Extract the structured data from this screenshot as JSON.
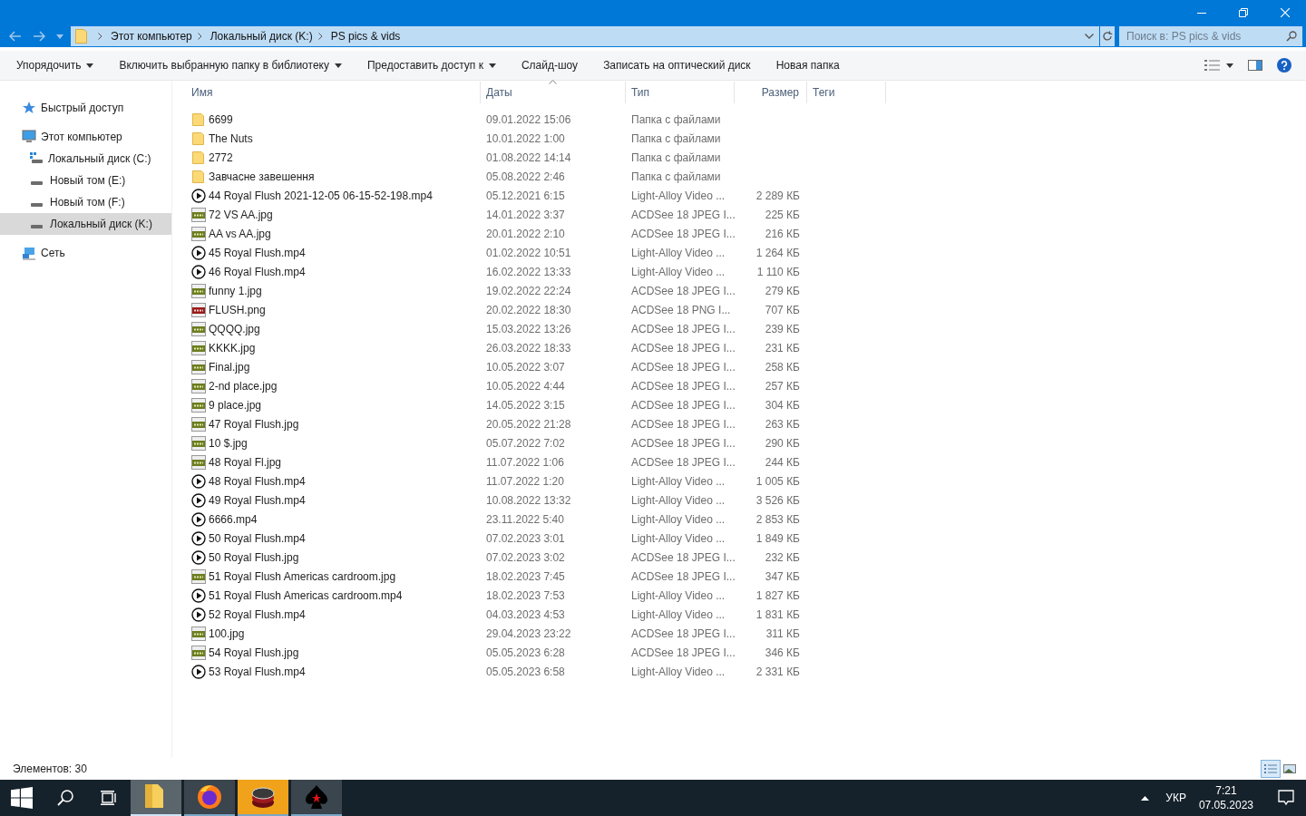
{
  "address_bar": {
    "crumbs": [
      "Этот компьютер",
      "Локальный диск (K:)",
      "PS pics & vids"
    ]
  },
  "search": {
    "placeholder": "Поиск в: PS pics & vids"
  },
  "toolbar": [
    {
      "label": "Упорядочить",
      "dropdown": true
    },
    {
      "label": "Включить выбранную папку в библиотеку",
      "dropdown": true
    },
    {
      "label": "Предоставить доступ к",
      "dropdown": true
    },
    {
      "label": "Слайд-шоу",
      "dropdown": false
    },
    {
      "label": "Записать на оптический диск",
      "dropdown": false
    },
    {
      "label": "Новая папка",
      "dropdown": false
    }
  ],
  "sidebar": {
    "items": [
      {
        "label": "Быстрый доступ",
        "kind": "star",
        "selected": false
      },
      {
        "label": "Этот компьютер",
        "kind": "computer",
        "selected": false,
        "children": [
          {
            "label": "Локальный диск (C:)",
            "kind": "system-drive",
            "selected": false
          },
          {
            "label": "Новый том (E:)",
            "kind": "drive",
            "selected": false
          },
          {
            "label": "Новый том (F:)",
            "kind": "drive",
            "selected": false
          },
          {
            "label": "Локальный диск (K:)",
            "kind": "drive",
            "selected": true
          }
        ]
      },
      {
        "label": "Сеть",
        "kind": "network",
        "selected": false
      }
    ]
  },
  "table": {
    "columns": [
      {
        "label": "Имя",
        "sorted": false
      },
      {
        "label": "Даты",
        "sorted": true
      },
      {
        "label": "Тип",
        "sorted": false
      },
      {
        "label": "Размер",
        "sorted": false
      },
      {
        "label": "Теги",
        "sorted": false
      }
    ],
    "rows": [
      {
        "kind": "folder",
        "name": "6699",
        "date": "09.01.2022 15:06",
        "type": "Папка с файлами"
      },
      {
        "kind": "folder",
        "name": "The Nuts",
        "date": "10.01.2022 1:00",
        "type": "Папка с файлами"
      },
      {
        "kind": "folder",
        "name": "2772",
        "date": "01.08.2022 14:14",
        "type": "Папка с файлами"
      },
      {
        "kind": "folder",
        "name": "Завчасне завешення",
        "date": "05.08.2022 2:46",
        "type": "Папка с файлами"
      },
      {
        "kind": "video",
        "name": "44 Royal Flush 2021-12-05 06-15-52-198.mp4",
        "date": "05.12.2021 6:15",
        "type": "Light-Alloy Video ...",
        "size": "2 289 КБ"
      },
      {
        "kind": "jpg",
        "name": "72 VS AA.jpg",
        "date": "14.01.2022 3:37",
        "type": "ACDSee 18 JPEG I...",
        "size": "225 КБ"
      },
      {
        "kind": "jpg",
        "name": "AA vs AA.jpg",
        "date": "20.01.2022 2:10",
        "type": "ACDSee 18 JPEG I...",
        "size": "216 КБ"
      },
      {
        "kind": "video",
        "name": "45 Royal Flush.mp4",
        "date": "01.02.2022 10:51",
        "type": "Light-Alloy Video ...",
        "size": "1 264 КБ"
      },
      {
        "kind": "video",
        "name": "46 Royal Flush.mp4",
        "date": "16.02.2022 13:33",
        "type": "Light-Alloy Video ...",
        "size": "1 110 КБ"
      },
      {
        "kind": "jpg",
        "name": "funny 1.jpg",
        "date": "19.02.2022 22:24",
        "type": "ACDSee 18 JPEG I...",
        "size": "279 КБ"
      },
      {
        "kind": "png",
        "name": "FLUSH.png",
        "date": "20.02.2022 18:30",
        "type": "ACDSee 18 PNG I...",
        "size": "707 КБ"
      },
      {
        "kind": "jpg",
        "name": "QQQQ.jpg",
        "date": "15.03.2022 13:26",
        "type": "ACDSee 18 JPEG I...",
        "size": "239 КБ"
      },
      {
        "kind": "jpg",
        "name": "KKKK.jpg",
        "date": "26.03.2022 18:33",
        "type": "ACDSee 18 JPEG I...",
        "size": "231 КБ"
      },
      {
        "kind": "jpg",
        "name": "Final.jpg",
        "date": "10.05.2022 3:07",
        "type": "ACDSee 18 JPEG I...",
        "size": "258 КБ"
      },
      {
        "kind": "jpg",
        "name": "2-nd place.jpg",
        "date": "10.05.2022 4:44",
        "type": "ACDSee 18 JPEG I...",
        "size": "257 КБ"
      },
      {
        "kind": "jpg",
        "name": "9 place.jpg",
        "date": "14.05.2022 3:15",
        "type": "ACDSee 18 JPEG I...",
        "size": "304 КБ"
      },
      {
        "kind": "jpg",
        "name": "47 Royal Flush.jpg",
        "date": "20.05.2022 21:28",
        "type": "ACDSee 18 JPEG I...",
        "size": "263 КБ"
      },
      {
        "kind": "jpg",
        "name": "10 $.jpg",
        "date": "05.07.2022 7:02",
        "type": "ACDSee 18 JPEG I...",
        "size": "290 КБ"
      },
      {
        "kind": "jpg",
        "name": "48 Royal Fl.jpg",
        "date": "11.07.2022 1:06",
        "type": "ACDSee 18 JPEG I...",
        "size": "244 КБ"
      },
      {
        "kind": "video",
        "name": "48 Royal Flush.mp4",
        "date": "11.07.2022 1:20",
        "type": "Light-Alloy Video ...",
        "size": "1 005 КБ"
      },
      {
        "kind": "video",
        "name": "49 Royal Flush.mp4",
        "date": "10.08.2022 13:32",
        "type": "Light-Alloy Video ...",
        "size": "3 526 КБ"
      },
      {
        "kind": "video",
        "name": "6666.mp4",
        "date": "23.11.2022 5:40",
        "type": "Light-Alloy Video ...",
        "size": "2 853 КБ"
      },
      {
        "kind": "video",
        "name": "50 Royal Flush.mp4",
        "date": "07.02.2023 3:01",
        "type": "Light-Alloy Video ...",
        "size": "1 849 КБ"
      },
      {
        "kind": "video",
        "name": "50 Royal Flush.jpg",
        "date": "07.02.2023 3:02",
        "type": "ACDSee 18 JPEG I...",
        "size": "232 КБ"
      },
      {
        "kind": "jpg",
        "name": "51 Royal Flush Americas cardroom.jpg",
        "date": "18.02.2023 7:45",
        "type": "ACDSee 18 JPEG I...",
        "size": "347 КБ"
      },
      {
        "kind": "video",
        "name": "51 Royal Flush Americas cardroom.mp4",
        "date": "18.02.2023 7:53",
        "type": "Light-Alloy Video ...",
        "size": "1 827 КБ"
      },
      {
        "kind": "video",
        "name": "52 Royal Flush.mp4",
        "date": "04.03.2023 4:53",
        "type": "Light-Alloy Video ...",
        "size": "1 831 КБ"
      },
      {
        "kind": "jpg",
        "name": "100.jpg",
        "date": "29.04.2023 23:22",
        "type": "ACDSee 18 JPEG I...",
        "size": "311 КБ"
      },
      {
        "kind": "jpg",
        "name": "54 Royal Flush.jpg",
        "date": "05.05.2023 6:28",
        "type": "ACDSee 18 JPEG I...",
        "size": "346 КБ"
      },
      {
        "kind": "video",
        "name": "53 Royal Flush.mp4",
        "date": "05.05.2023 6:58",
        "type": "Light-Alloy Video ...",
        "size": "2 331 КБ"
      }
    ]
  },
  "status_bar": {
    "count": "Элементов: 30",
    "views": [
      {
        "kind": "details",
        "selected": true
      },
      {
        "kind": "thumbnails",
        "selected": false
      }
    ]
  },
  "taskbar": {
    "apps": [
      {
        "kind": "explorer",
        "selected": true,
        "flashing": false
      },
      {
        "kind": "firefox",
        "selected": false,
        "flashing": false
      },
      {
        "kind": "chips",
        "selected": false,
        "flashing": true
      },
      {
        "kind": "spade",
        "selected": false,
        "flashing": false
      }
    ],
    "language": "УКР",
    "time": "7:21",
    "date": "07.05.2023"
  }
}
